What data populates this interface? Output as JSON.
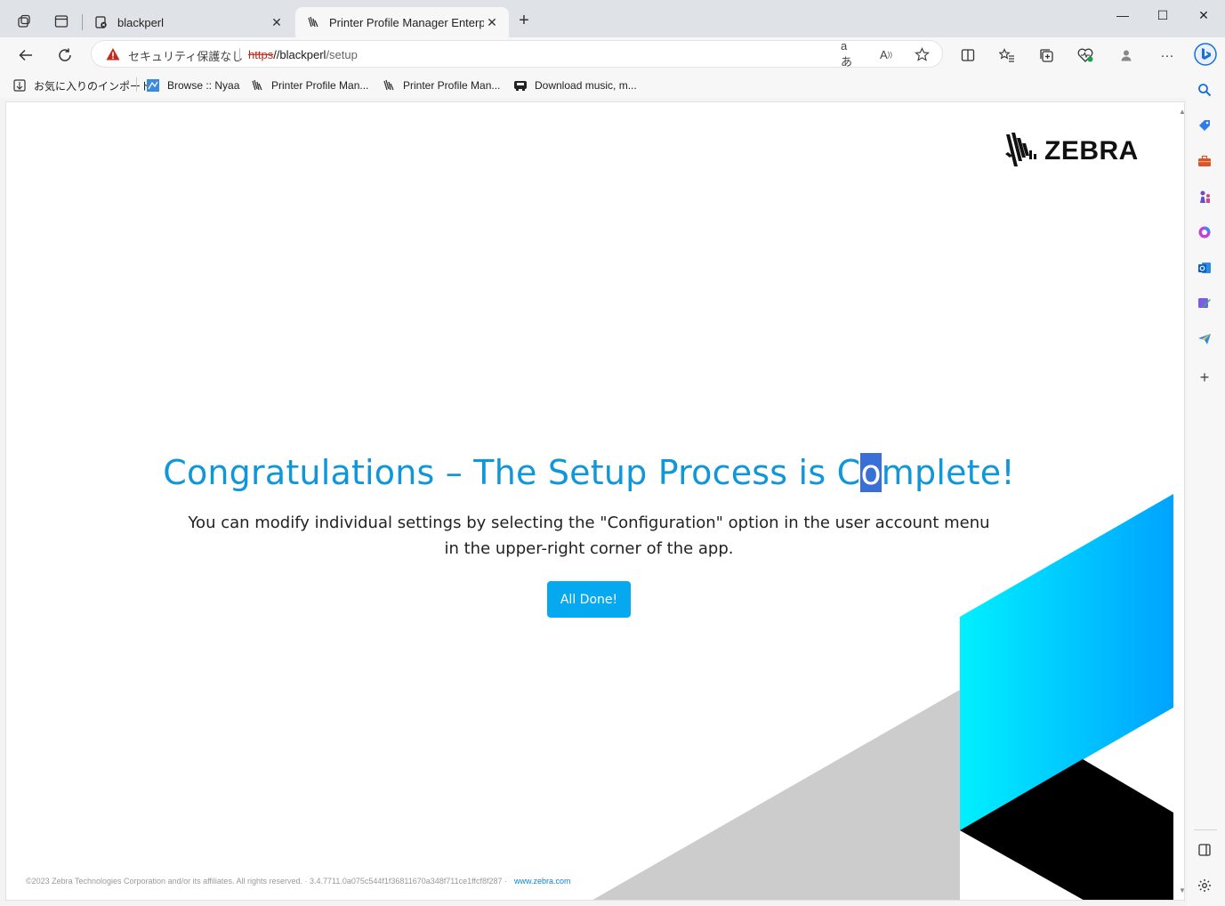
{
  "browser": {
    "tabs": [
      {
        "title": "blackperl",
        "active": false
      },
      {
        "title": "Printer Profile Manager Enterpris",
        "active": true
      }
    ],
    "new_tab": "+",
    "window_controls": {
      "minimize": "—",
      "maximize": "☐",
      "close": "✕"
    },
    "address": {
      "security_label": "セキュリティ保護なし",
      "scheme": "https",
      "host": "//blackperl",
      "path": "/setup"
    },
    "favorites": [
      {
        "label": "お気に入りのインポート",
        "icon": "import-icon"
      },
      {
        "label": "Browse :: Nyaa",
        "icon": "nyaa-icon"
      },
      {
        "label": "Printer Profile Man...",
        "icon": "zebra-icon"
      },
      {
        "label": "Printer Profile Man...",
        "icon": "zebra-icon"
      },
      {
        "label": "Download music, m...",
        "icon": "music-icon"
      }
    ]
  },
  "page": {
    "logo_text": "ZEBRA",
    "headline_before": "Congratulations – The Setup Process is C",
    "headline_selected": "o",
    "headline_after": "mplete!",
    "subtext": "You can modify individual settings by selecting the \"Configuration\" option in the user account menu in the upper-right corner of the app.",
    "button_label": "All Done!",
    "footer_text": "©2023 Zebra Technologies Corporation and/or its affiliates. All rights reserved. · 3.4.7711.0a075c544f1f36811670a348f711ce1ffcf8f287 ·",
    "footer_link": "www.zebra.com"
  },
  "colors": {
    "accent": "#0f97d9",
    "button": "#06a9f0",
    "selection": "#3a6fd8"
  }
}
